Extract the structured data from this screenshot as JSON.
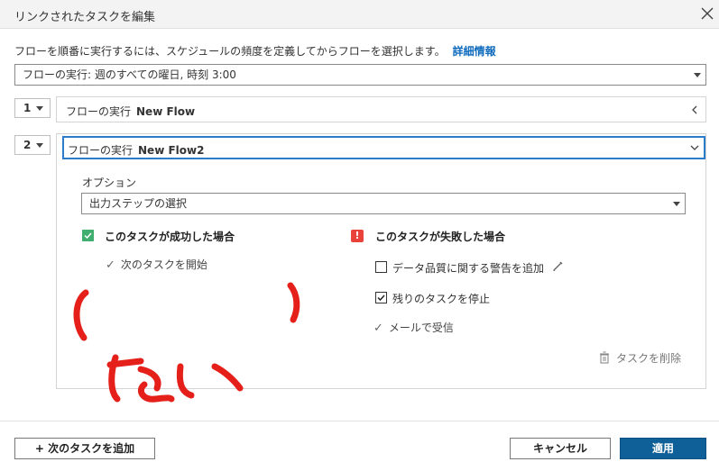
{
  "window": {
    "title": "リンクされたタスクを編集"
  },
  "intro": {
    "text": "フローを順番に実行するには、スケジュールの頻度を定義してからフローを選択します。",
    "link": "詳細情報"
  },
  "schedule": {
    "value": "フローの実行: 週のすべての曜日, 時刻 3:00"
  },
  "steps": [
    {
      "number": "1",
      "prefix": "フローの実行",
      "flow": "New Flow"
    },
    {
      "number": "2",
      "prefix": "フローの実行",
      "flow": "New Flow2"
    }
  ],
  "options": {
    "label": "オプション",
    "output_select": "出力ステップの選択"
  },
  "success": {
    "heading": "このタスクが成功した場合",
    "action": "次のタスクを開始"
  },
  "failure": {
    "heading": "このタスクが失敗した場合",
    "data_quality_warning": "データ品質に関する警告を追加",
    "stop_remaining": "残りのタスクを停止",
    "mail": "メールで受信",
    "error_symbol": "!"
  },
  "delete_task": "タスクを削除",
  "buttons": {
    "add_next": "+ 次のタスクを追加",
    "cancel": "キャンセル",
    "apply": "適用"
  },
  "colors": {
    "accent": "#0f5f98",
    "link": "#0f6bbd",
    "success": "#3fae6f",
    "error": "#e8423a",
    "annotation": "#e5201a"
  },
  "checkboxes": {
    "data_quality_warning": false,
    "stop_remaining": true
  },
  "annotation": {
    "handwritten": "ない"
  }
}
